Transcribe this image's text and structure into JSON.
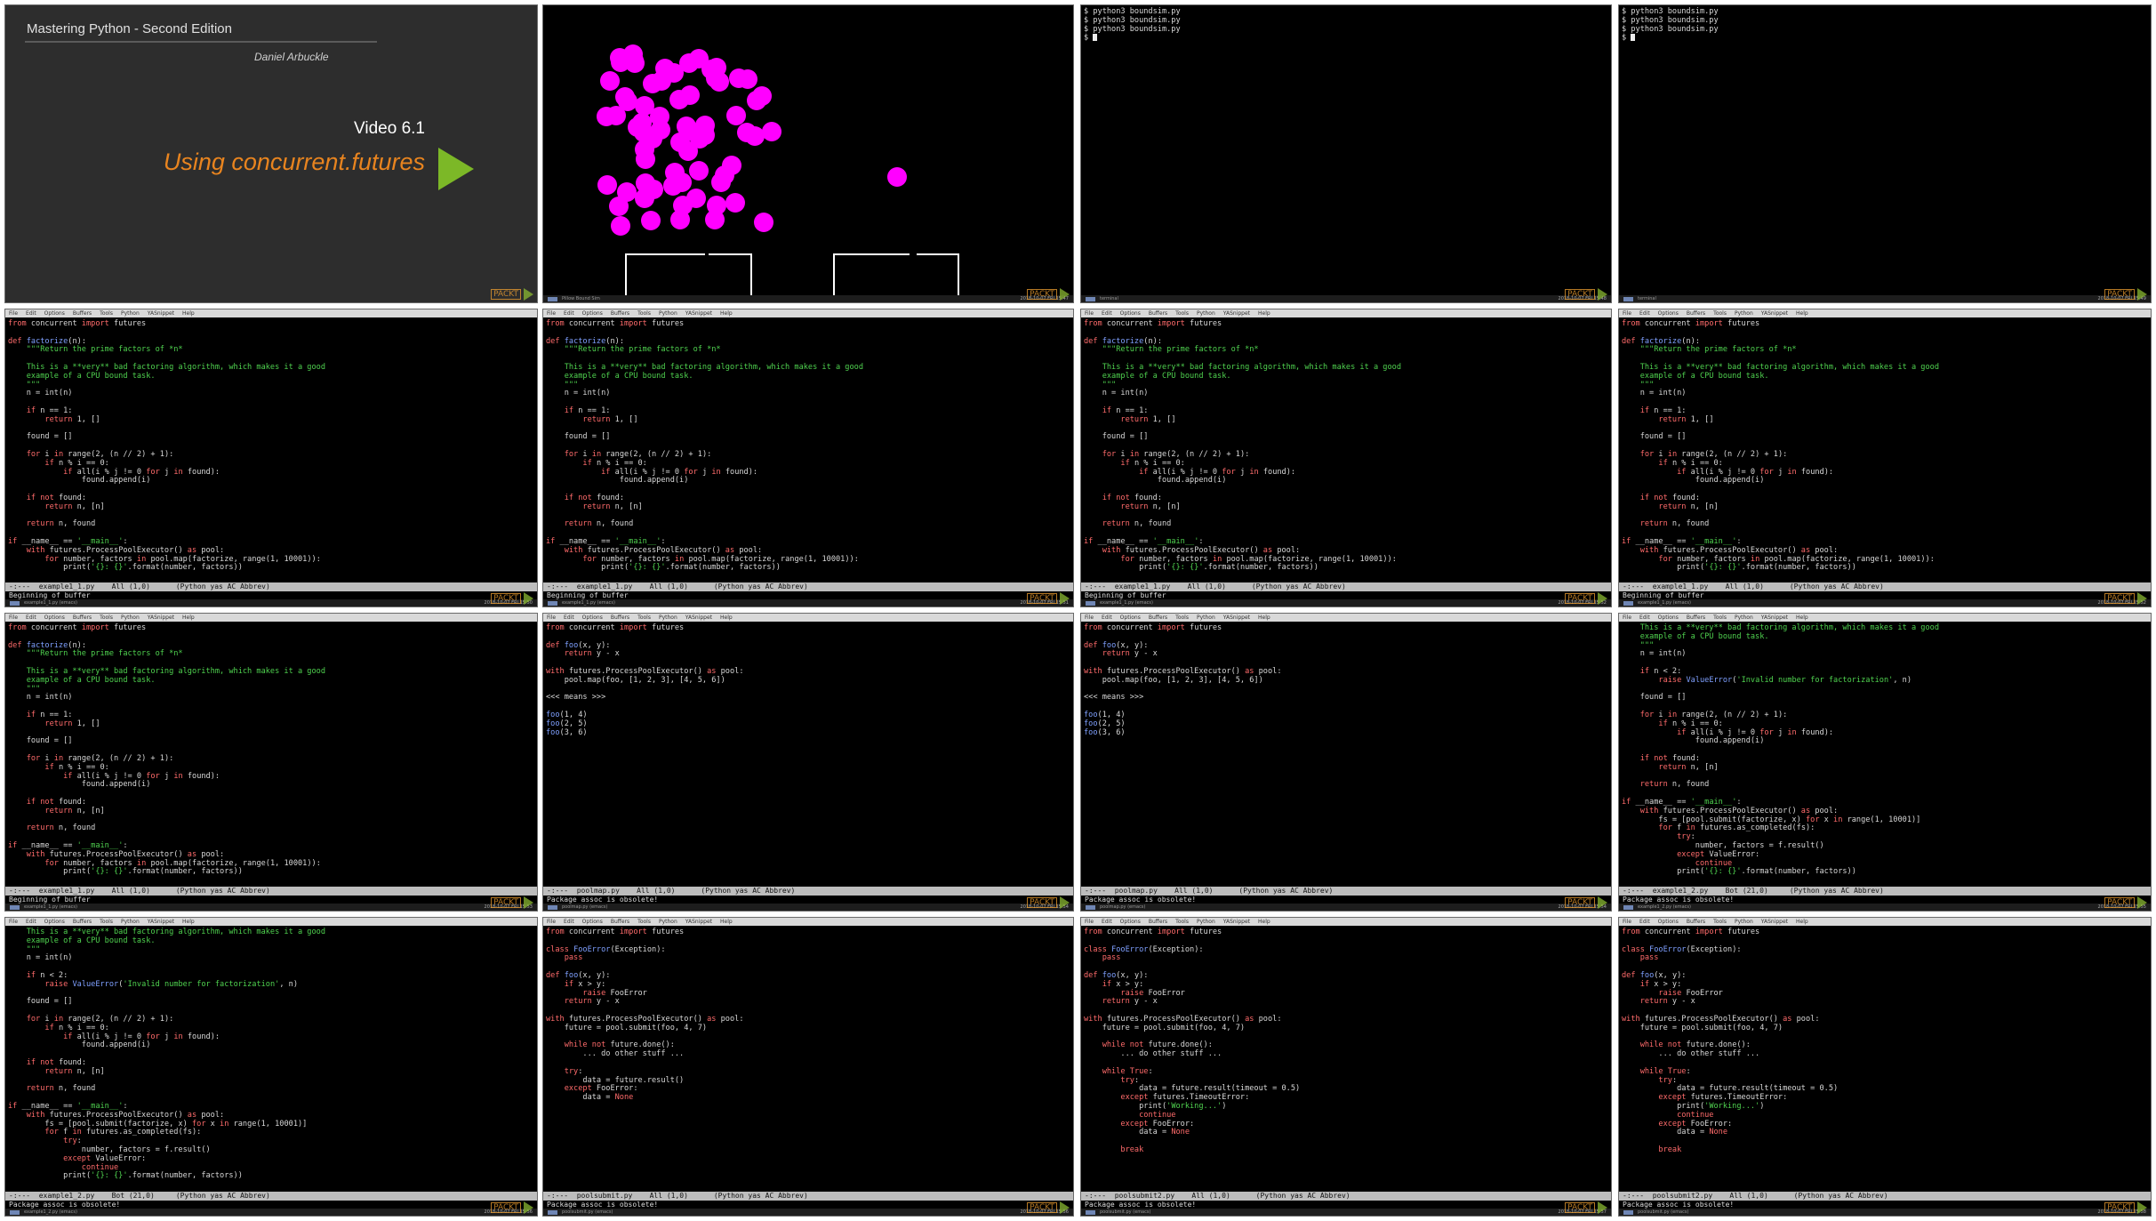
{
  "title_card": {
    "course": "Mastering Python - Second Edition",
    "author": "Daniel Arbuckle",
    "video": "Video 6.1",
    "topic": "Using concurrent.futures"
  },
  "bouncing_window_label": "Pillow Bound Sim",
  "packt_logo": "PACKT",
  "clocks": [
    "2018-10-07 FRI 15:47",
    "2018-10-07 FRI 15:47",
    "2018-10-07 FRI 15:48",
    "2018-10-07 FRI 15:49",
    "2018-10-07 FRI 15:50",
    "2018-10-07 FRI 15:51",
    "2018-10-07 FRI 15:52",
    "2018-10-07 FRI 15:52",
    "2018-10-07 FRI 15:53",
    "2018-10-07 FRI 15:54",
    "2018-10-07 FRI 15:54",
    "2018-10-07 FRI 15:55",
    "2018-10-07 FRI 15:56",
    "2018-10-07 FRI 15:56",
    "2018-10-07 FRI 15:57",
    "2018-10-07 FRI 15:58"
  ],
  "emacs_menu": [
    "File",
    "Edit",
    "Options",
    "Buffers",
    "Tools",
    "Python",
    "YASnippet",
    "Help"
  ],
  "terminal_lines": [
    "$ python3 boundsim.py",
    "$ python3 boundsim.py",
    "$ python3 boundsim.py",
    "$"
  ],
  "modelines": {
    "example1": "-:---  example1_1.py    All (1,0)      (Python yas AC Abbrev)",
    "poolmap": "-:---  poolmap.py    All (1,0)      (Python yas AC Abbrev)",
    "example2": "-:---  example1_2.py    Bot (21,0)     (Python yas AC Abbrev)",
    "poolsubmit": "-:---  poolsubmit.py    All (1,0)      (Python yas AC Abbrev)",
    "poolsubmit2": "-:---  poolsubmit2.py    All (1,0)      (Python yas AC Abbrev)"
  },
  "echo_lines": {
    "beginning": "Beginning of buffer",
    "obsolete": "Package assoc is obsolete!"
  },
  "taskbar_labels": {
    "sim": "Pillow Bound Sim",
    "term": "terminal",
    "example1": "example1_1.py (emacs)",
    "poolmap": "poolmap.py (emacs)",
    "example2": "example1_2.py (emacs)",
    "poolsubmit": "poolsubmit.py (emacs)"
  },
  "code": {
    "example1": [
      "from concurrent import futures",
      "",
      "def factorize(n):",
      "    \"\"\"Return the prime factors of *n*",
      "",
      "    This is a **very** bad factoring algorithm, which makes it a good",
      "    example of a CPU bound task.",
      "    \"\"\"",
      "    n = int(n)",
      "",
      "    if n == 1:",
      "        return 1, []",
      "",
      "    found = []",
      "",
      "    for i in range(2, (n // 2) + 1):",
      "        if n % i == 0:",
      "            if all(i % j != 0 for j in found):",
      "                found.append(i)",
      "",
      "    if not found:",
      "        return n, [n]",
      "",
      "    return n, found",
      "",
      "if __name__ == '__main__':",
      "    with futures.ProcessPoolExecutor() as pool:",
      "        for number, factors in pool.map(factorize, range(1, 10001)):",
      "            print('{}: {}'.format(number, factors))"
    ],
    "poolmap": [
      "from concurrent import futures",
      "",
      "def foo(x, y):",
      "    return y - x",
      "",
      "with futures.ProcessPoolExecutor() as pool:",
      "    pool.map(foo, [1, 2, 3], [4, 5, 6])",
      "",
      "<<< means >>>",
      "",
      "foo(1, 4)",
      "foo(2, 5)",
      "foo(3, 6)"
    ],
    "example2": [
      "    This is a **very** bad factoring algorithm, which makes it a good",
      "    example of a CPU bound task.",
      "    \"\"\"",
      "    n = int(n)",
      "",
      "    if n < 2:",
      "        raise ValueError('Invalid number for factorization', n)",
      "",
      "    found = []",
      "",
      "    for i in range(2, (n // 2) + 1):",
      "        if n % i == 0:",
      "            if all(i % j != 0 for j in found):",
      "                found.append(i)",
      "",
      "    if not found:",
      "        return n, [n]",
      "",
      "    return n, found",
      "",
      "if __name__ == '__main__':",
      "    with futures.ProcessPoolExecutor() as pool:",
      "        fs = [pool.submit(factorize, x) for x in range(1, 10001)]",
      "        for f in futures.as_completed(fs):",
      "            try:",
      "                number, factors = f.result()",
      "            except ValueError:",
      "                continue",
      "            print('{}: {}'.format(number, factors))"
    ],
    "poolsubmit": [
      "from concurrent import futures",
      "",
      "class FooError(Exception):",
      "    pass",
      "",
      "def foo(x, y):",
      "    if x > y:",
      "        raise FooError",
      "    return y - x",
      "",
      "with futures.ProcessPoolExecutor() as pool:",
      "    future = pool.submit(foo, 4, 7)",
      "",
      "    while not future.done():",
      "        ... do other stuff ...",
      "",
      "    try:",
      "        data = future.result()",
      "    except FooError:",
      "        data = None"
    ],
    "poolsubmit2": [
      "from concurrent import futures",
      "",
      "class FooError(Exception):",
      "    pass",
      "",
      "def foo(x, y):",
      "    if x > y:",
      "        raise FooError",
      "    return y - x",
      "",
      "with futures.ProcessPoolExecutor() as pool:",
      "    future = pool.submit(foo, 4, 7)",
      "",
      "    while not future.done():",
      "        ... do other stuff ...",
      "",
      "    while True:",
      "        try:",
      "            data = future.result(timeout = 0.5)",
      "        except futures.TimeoutError:",
      "            print('Working...')",
      "            continue",
      "        except FooError:",
      "            data = None",
      "",
      "        break"
    ]
  },
  "colors": {
    "ball": "#ff00ff",
    "title_orange": "#e8841f",
    "play_green": "#7cb827",
    "comment_green": "#4fd24f",
    "keyword_red": "#ff6b6b"
  }
}
